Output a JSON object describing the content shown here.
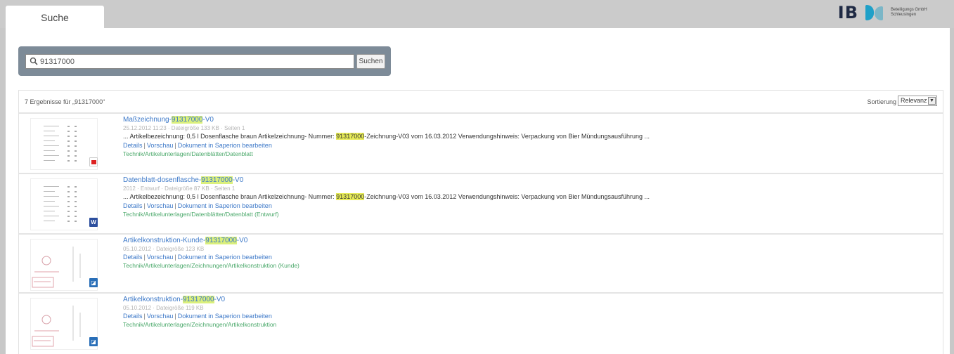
{
  "tab": {
    "label": "Suche"
  },
  "search": {
    "value": "91317000",
    "button_label": "Suchen"
  },
  "results": {
    "count_label": "7 Ergebnisse für „91317000“",
    "sort_label": "Sortierung",
    "sort_value": "Relevanz",
    "items": [
      {
        "title_prefix": "Maßzeichnung-",
        "title_highlight": "91317000",
        "title_suffix": "-V0",
        "meta": "25.12.2012 11:23 · Dateigröße 133 KB · Seiten 1",
        "snippet_before": "... Artikelbezeichnung: 0,5 l Dosenflasche braun Artikelzeichnung- Nummer: ",
        "snippet_highlight": "91317000",
        "snippet_after": "-Zeichnung-V03 vom 16.03.2012 Verwendungshinweis: Verpackung von Bier Mündungsausführung ...",
        "links": [
          "Details",
          "Vorschau",
          "Dokument in Saperion bearbeiten"
        ],
        "path": "Technik/Artikelunterlagen/Datenblätter/Datenblatt",
        "icon": "pdf-icon"
      },
      {
        "title_prefix": "Datenblatt-dosenflasche-",
        "title_highlight": "91317000",
        "title_suffix": "-V0",
        "meta": "2012 · Entwurf · Dateigröße 87 KB · Seiten 1",
        "snippet_before": "... Artikelbezeichnung: 0,5 l Dosenflasche braun Artikelzeichnung- Nummer: ",
        "snippet_highlight": "91317000",
        "snippet_after": "-Zeichnung-V03 vom 16.03.2012 Verwendungshinweis: Verpackung von Bier Mündungsausführung ...",
        "links": [
          "Details",
          "Vorschau",
          "Dokument in Saperion bearbeiten"
        ],
        "path": "Technik/Artikelunterlagen/Datenblätter/Datenblatt (Entwurf)",
        "icon": "word-icon"
      },
      {
        "title_prefix": "Artikelkonstruktion-Kunde-",
        "title_highlight": "91317000",
        "title_suffix": "-V0",
        "meta": "05.10.2012 · Dateigröße 123 KB",
        "snippet_before": "",
        "snippet_highlight": "",
        "snippet_after": "",
        "links": [
          "Details",
          "Vorschau",
          "Dokument in Saperion bearbeiten"
        ],
        "path": "Technik/Artikelunterlagen/Zeichnungen/Artikelkonstruktion (Kunde)",
        "icon": "image-icon"
      },
      {
        "title_prefix": "Artikelkonstruktion-",
        "title_highlight": "91317000",
        "title_suffix": "-V0",
        "meta": "05.10.2012 · Dateigröße 119 KB",
        "snippet_before": "",
        "snippet_highlight": "",
        "snippet_after": "",
        "links": [
          "Details",
          "Vorschau",
          "Dokument in Saperion bearbeiten"
        ],
        "path": "Technik/Artikelunterlagen/Zeichnungen/Artikelkonstruktion",
        "icon": "image-icon"
      }
    ]
  }
}
